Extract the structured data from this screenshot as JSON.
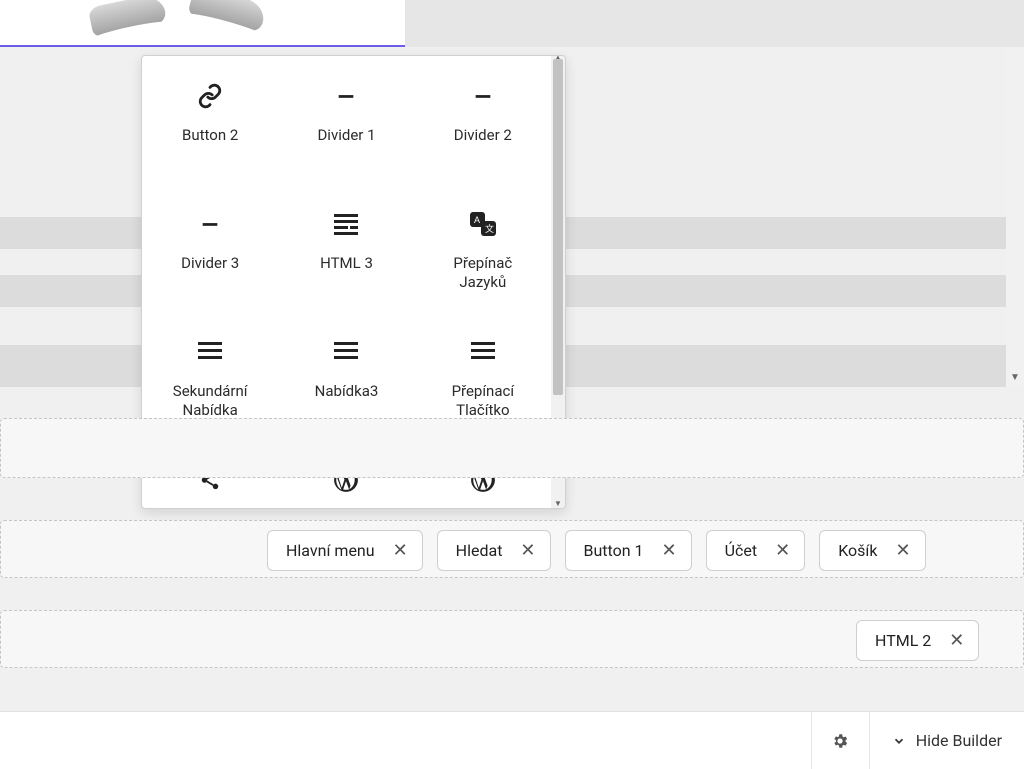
{
  "picker": {
    "items": [
      {
        "icon": "link",
        "label": "Button 2"
      },
      {
        "icon": "divider",
        "label": "Divider 1"
      },
      {
        "icon": "divider",
        "label": "Divider 2"
      },
      {
        "icon": "divider",
        "label": "Divider 3"
      },
      {
        "icon": "html",
        "label": "HTML 3"
      },
      {
        "icon": "translate",
        "label": "Přepínač\nJazyků"
      },
      {
        "icon": "menu",
        "label": "Sekundární\nNabídka"
      },
      {
        "icon": "menu",
        "label": "Nabídka3"
      },
      {
        "icon": "menu",
        "label": "Přepínací\nTlačítko"
      },
      {
        "icon": "share",
        "label": ""
      },
      {
        "icon": "wordpress",
        "label": ""
      },
      {
        "icon": "wordpress",
        "label": ""
      }
    ]
  },
  "row2": {
    "chips": [
      "Hlavní menu",
      "Hledat",
      "Button 1",
      "Účet",
      "Košík"
    ]
  },
  "row3": {
    "chips": [
      "HTML 2"
    ]
  },
  "bottom": {
    "hide_label": "Hide Builder"
  }
}
